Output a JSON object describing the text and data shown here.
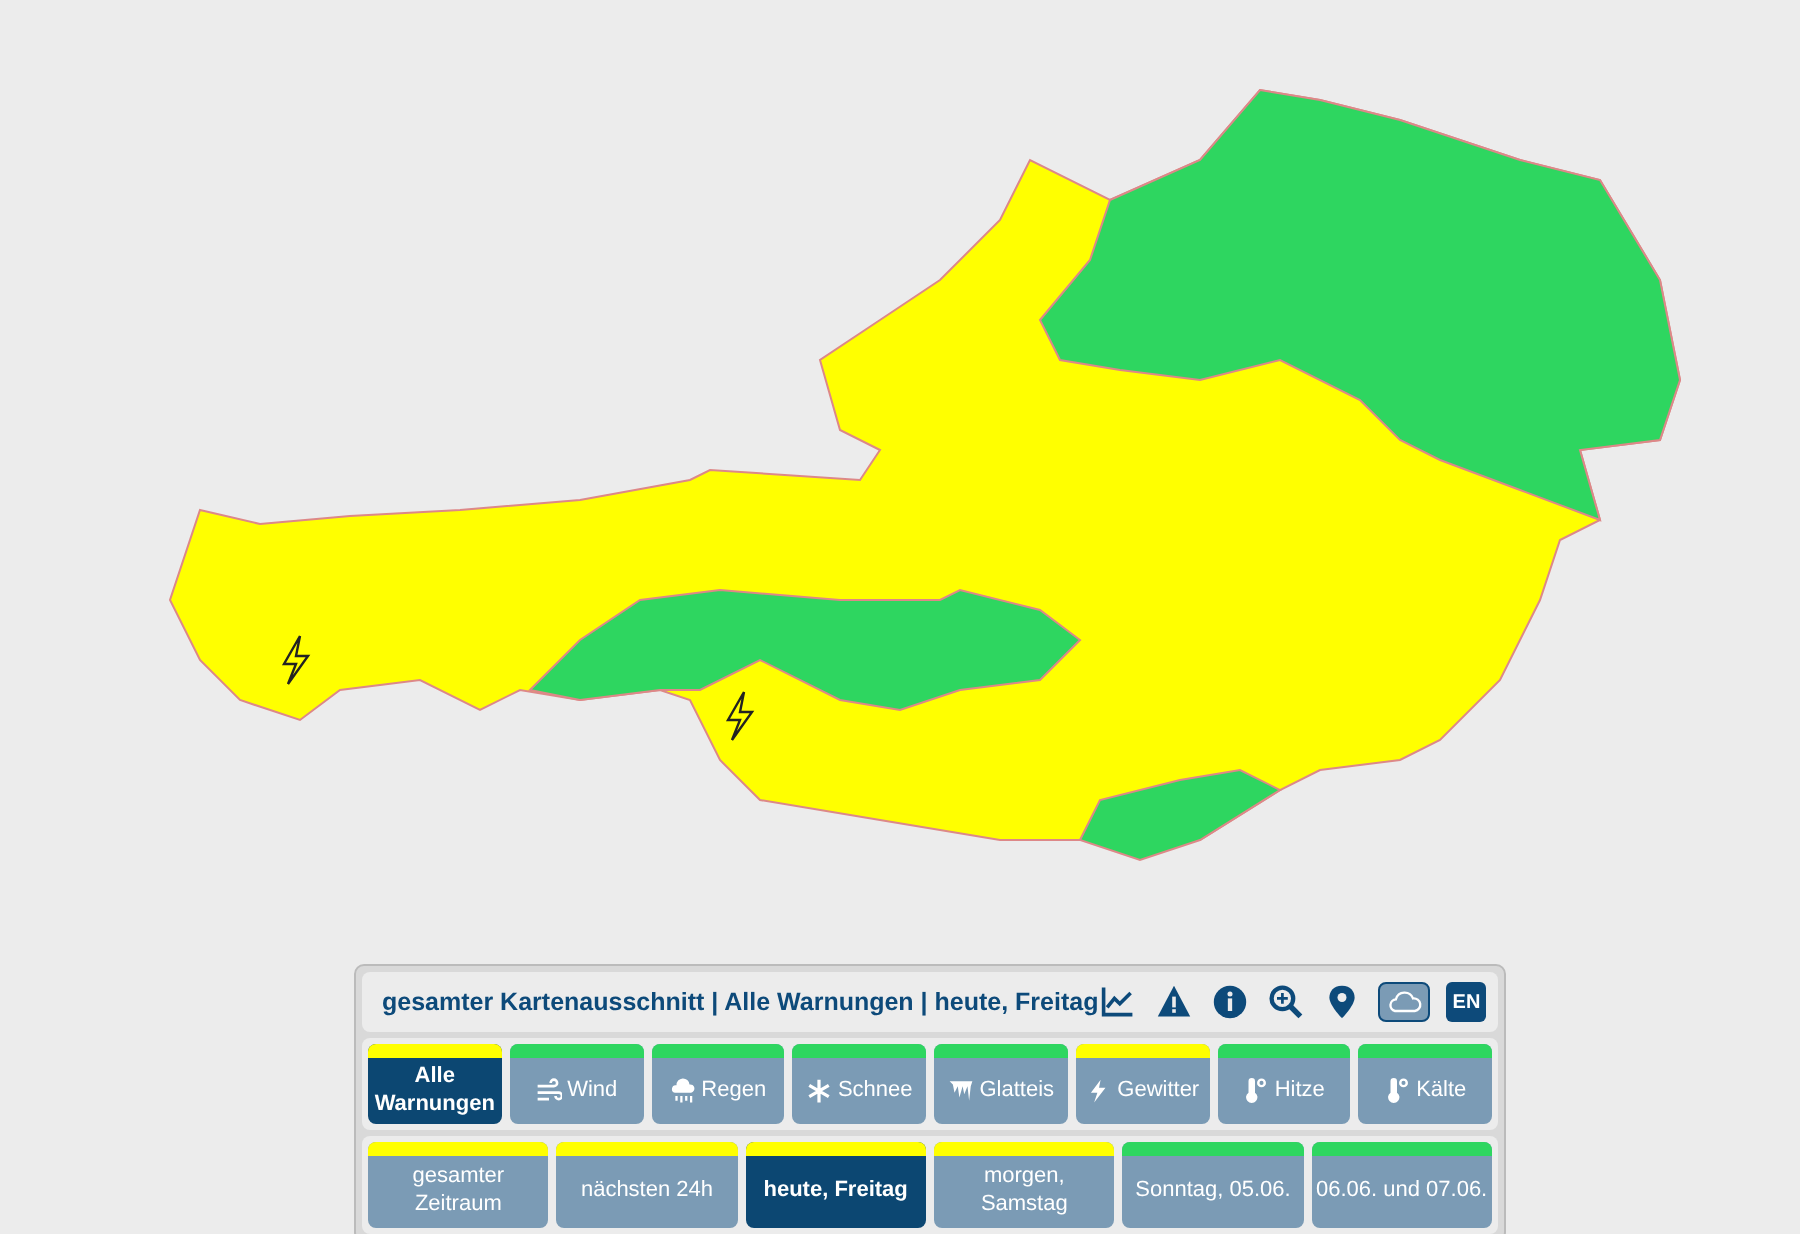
{
  "header": {
    "title": "gesamter Kartenausschnitt | Alle Warnungen | heute, Freitag"
  },
  "toolbar": [
    {
      "kind": "chart",
      "selected": false
    },
    {
      "kind": "warning",
      "selected": false
    },
    {
      "kind": "info",
      "selected": false
    },
    {
      "kind": "zoom",
      "selected": false
    },
    {
      "kind": "location",
      "selected": false
    },
    {
      "kind": "cloud",
      "selected": true
    },
    {
      "kind": "language",
      "label": "EN",
      "selected": false
    }
  ],
  "categories": [
    {
      "kind": "all",
      "label": "Alle Warnungen",
      "color": "#ffff00",
      "selected": true
    },
    {
      "kind": "wind",
      "label": "Wind",
      "color": "#2ed660",
      "selected": false
    },
    {
      "kind": "rain",
      "label": "Regen",
      "color": "#2ed660",
      "selected": false
    },
    {
      "kind": "snow",
      "label": "Schnee",
      "color": "#2ed660",
      "selected": false
    },
    {
      "kind": "ice",
      "label": "Glatteis",
      "color": "#2ed660",
      "selected": false
    },
    {
      "kind": "thunder",
      "label": "Gewitter",
      "color": "#ffff00",
      "selected": false
    },
    {
      "kind": "heat",
      "label": "Hitze",
      "color": "#2ed660",
      "selected": false
    },
    {
      "kind": "cold",
      "label": "Kälte",
      "color": "#2ed660",
      "selected": false
    }
  ],
  "periods": [
    {
      "label": "gesamter Zeitraum",
      "color": "#ffff00",
      "selected": false
    },
    {
      "label": "nächsten 24h",
      "color": "#ffff00",
      "selected": false
    },
    {
      "label": "heute, Freitag",
      "color": "#ffff00",
      "selected": true
    },
    {
      "label": "morgen, Samstag",
      "color": "#ffff00",
      "selected": false
    },
    {
      "label": "Sonntag, 05.06.",
      "color": "#2ed660",
      "selected": false
    },
    {
      "label": "06.06. und 07.06.",
      "color": "#2ed660",
      "selected": false
    }
  ]
}
